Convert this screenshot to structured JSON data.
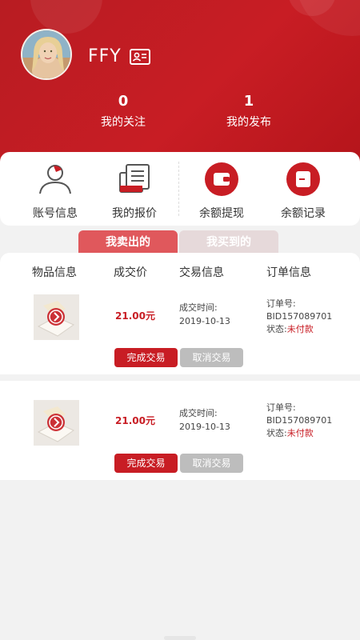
{
  "profile": {
    "username": "FFY",
    "stats": [
      {
        "num": "0",
        "label": "我的关注"
      },
      {
        "num": "1",
        "label": "我的发布"
      }
    ]
  },
  "quick_actions": [
    {
      "label": "账号信息",
      "icon": "person-icon"
    },
    {
      "label": "我的报价",
      "icon": "document-icon"
    },
    {
      "label": "余额提现",
      "icon": "wallet-icon"
    },
    {
      "label": "余额记录",
      "icon": "record-icon"
    }
  ],
  "tabs": [
    {
      "label": "我卖出的",
      "active": true
    },
    {
      "label": "我买到的",
      "active": false
    }
  ],
  "columns": [
    "物品信息",
    "成交价",
    "交易信息",
    "订单信息"
  ],
  "orders": [
    {
      "price": "21.00元",
      "trade_label": "成交时间:",
      "trade_date": "2019-10-13",
      "order_no_label": "订单号:",
      "order_no": "BID157089701",
      "status_label": "状态:",
      "status": "未付款",
      "confirm_label": "完成交易",
      "cancel_label": "取消交易"
    },
    {
      "price": "21.00元",
      "trade_label": "成交时间:",
      "trade_date": "2019-10-13",
      "order_no_label": "订单号:",
      "order_no": "BID157089701",
      "status_label": "状态:",
      "status": "未付款",
      "confirm_label": "完成交易",
      "cancel_label": "取消交易"
    }
  ],
  "colors": {
    "brand_red": "#c81d24",
    "tab_active": "#e0585c",
    "tab_inactive": "#e6d9da",
    "cancel_gray": "#bdbdbd"
  }
}
